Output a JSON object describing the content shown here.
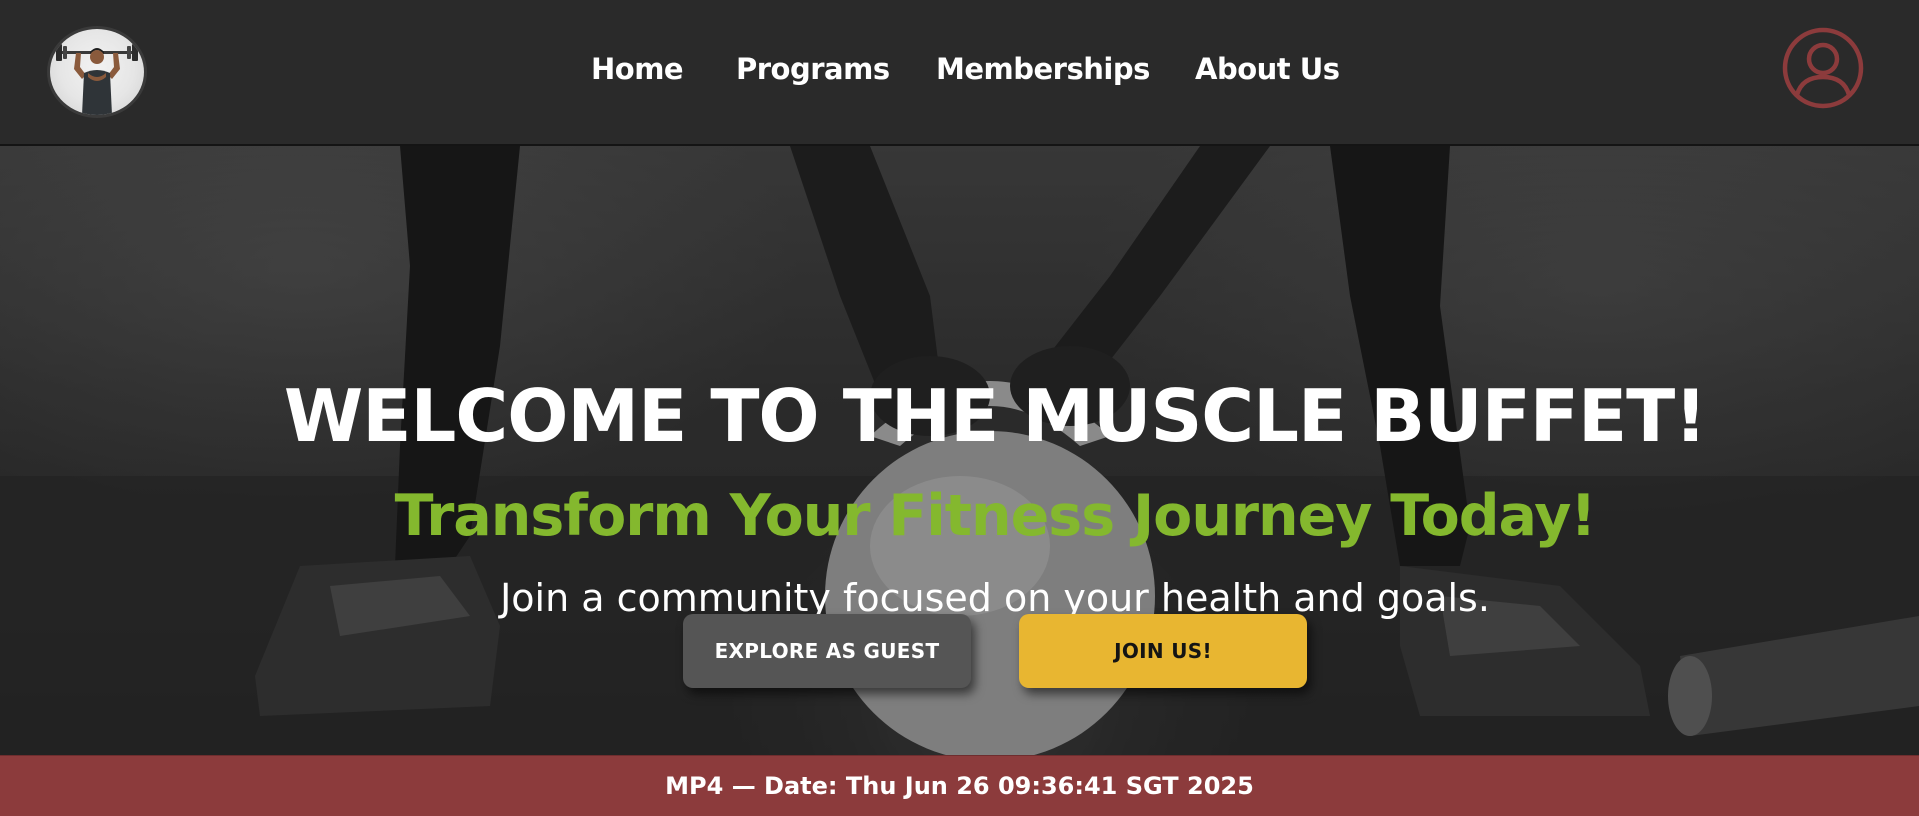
{
  "brand": {
    "logo_icon": "bodybuilder-logo-icon"
  },
  "nav": {
    "items": [
      {
        "label": "Home"
      },
      {
        "label": "Programs"
      },
      {
        "label": "Memberships"
      },
      {
        "label": "About Us"
      }
    ],
    "profile_icon": "user-profile-icon"
  },
  "hero": {
    "title": "WELCOME TO THE MUSCLE BUFFET!",
    "subtitle": "Transform Your Fitness Journey Today!",
    "tagline": "Join a community focused on your health and goals.",
    "buttons": {
      "guest_label": "EXPLORE AS GUEST",
      "join_label": "JOIN US!"
    },
    "background": "grayscale-kettlebell-gym-photo"
  },
  "footer": {
    "status_text": "MP4 — Date: Thu Jun 26 09:36:41 SGT 2025"
  },
  "colors": {
    "nav_bg": "#2a2a2a",
    "accent_green": "#84b82e",
    "join_yellow": "#e8b631",
    "guest_gray": "#555555",
    "footer_red": "#8c3b3c",
    "profile_red": "#8c3b3c"
  }
}
